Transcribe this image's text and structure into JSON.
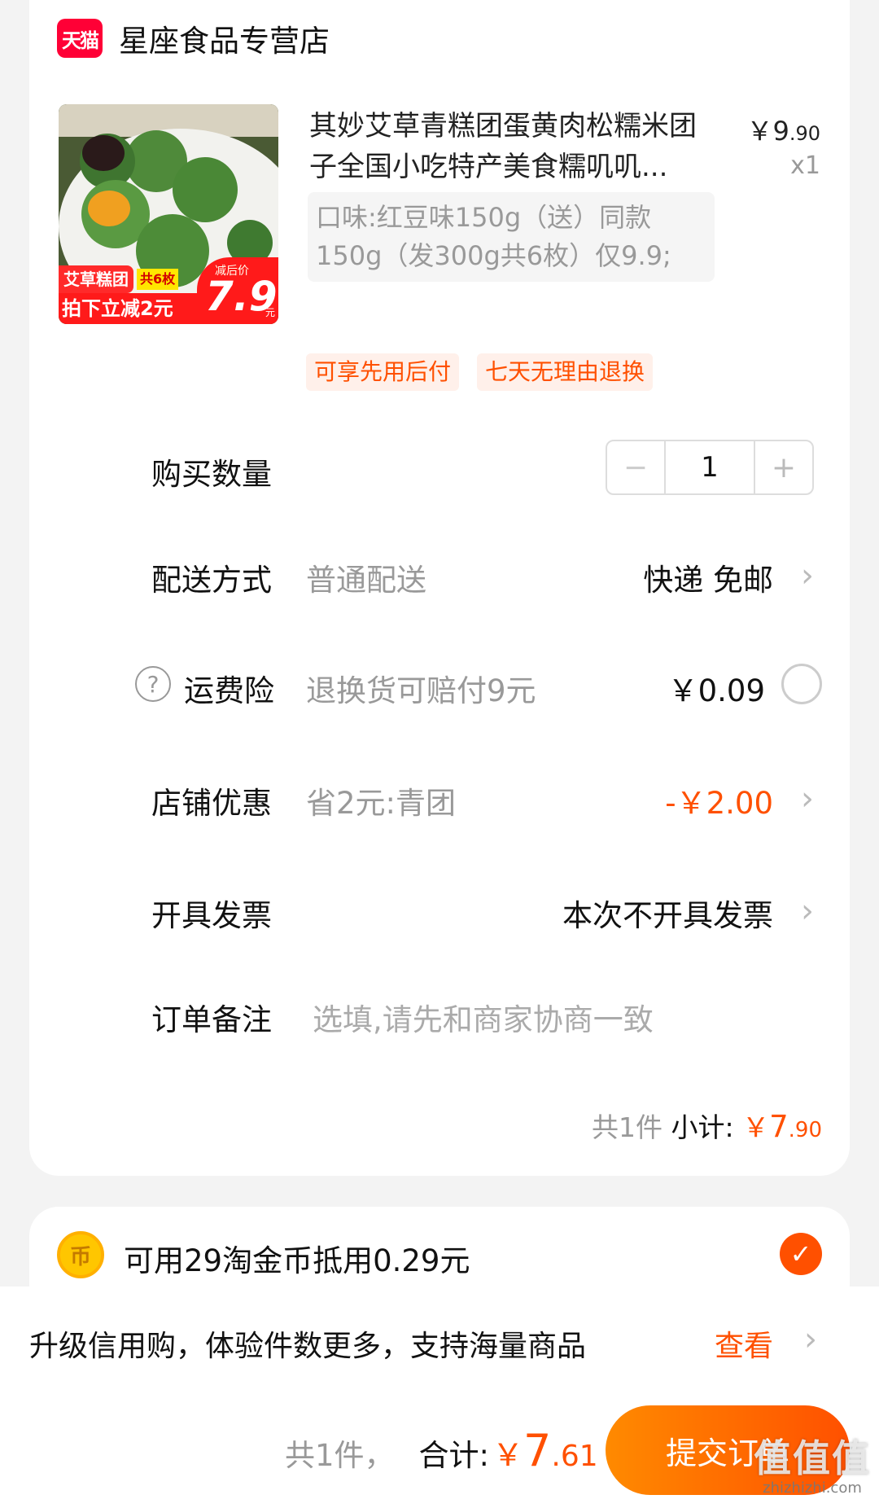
{
  "shop": {
    "badge": "天猫",
    "name": "星座食品专营店"
  },
  "product": {
    "title": "其妙艾草青糕团蛋黄肉松糯米团子全国小吃特产美食糯叽叽...",
    "price_symbol": "￥",
    "price_int": "9",
    "price_dec": ".90",
    "qty": "x1",
    "sku": "口味:红豆味150g（送）同款150g（发300g共6枚）仅9.9;",
    "image": {
      "label_tl": "艾草糕团",
      "label_count": "共6枚",
      "label_promo": "拍下立减2元",
      "label_after": "减后价",
      "label_price": "7.9",
      "label_unit": "元"
    },
    "tags": [
      "可享先用后付",
      "七天无理由退换"
    ]
  },
  "rows": {
    "quantity_label": "购买数量",
    "quantity_value": "1",
    "delivery_label": "配送方式",
    "delivery_sub": "普通配送",
    "delivery_value": "快递 免邮",
    "insurance_label": "运费险",
    "insurance_sub": "退换货可赔付9元",
    "insurance_value": "￥0.09",
    "discount_label": "店铺优惠",
    "discount_sub": "省2元:青团",
    "discount_value": "-￥2.00",
    "invoice_label": "开具发票",
    "invoice_value": "本次不开具发票",
    "note_label": "订单备注",
    "note_placeholder": "选填,请先和商家协商一致"
  },
  "subtotal": {
    "count": "共1件",
    "label": "小计:",
    "symbol": "￥",
    "int": "7",
    "dec": ".90"
  },
  "coins": {
    "icon_char": "币",
    "text": "可用29淘金币抵用0.29元",
    "checked": true
  },
  "bottom": {
    "promo_text": "升级信用购，体验件数更多，支持海量商品",
    "promo_link": "查看",
    "count": "共1件，",
    "total_label": "合计:",
    "total_symbol": "￥",
    "total_int": "7",
    "total_dec": ".61",
    "submit": "提交订单"
  },
  "watermark": {
    "logo": "值值值",
    "url": "zhizhizhi.com"
  },
  "colors": {
    "accent": "#ff5000",
    "tmall": "#ff0036",
    "muted": "#999999"
  }
}
